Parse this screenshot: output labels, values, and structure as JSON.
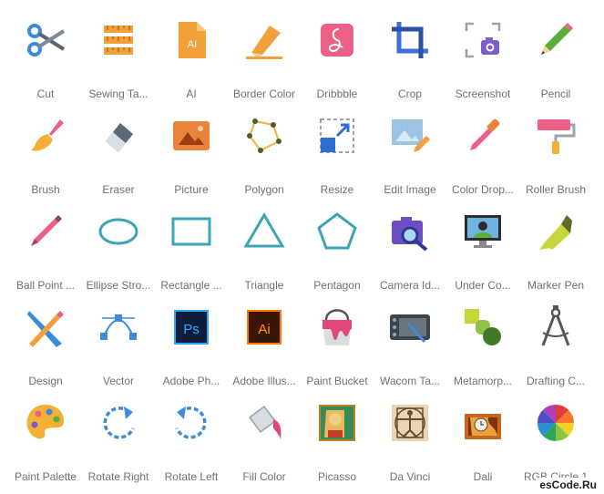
{
  "icons": [
    {
      "label": "Cut",
      "icon": "scissors-icon"
    },
    {
      "label": "Sewing Ta...",
      "icon": "tape-measure-icon"
    },
    {
      "label": "AI",
      "icon": "ai-file-icon"
    },
    {
      "label": "Border Color",
      "icon": "border-color-icon"
    },
    {
      "label": "Dribbble",
      "icon": "dribbble-icon"
    },
    {
      "label": "Crop",
      "icon": "crop-icon"
    },
    {
      "label": "Screenshot",
      "icon": "screenshot-icon"
    },
    {
      "label": "Pencil",
      "icon": "pencil-icon"
    },
    {
      "label": "Brush",
      "icon": "brush-icon"
    },
    {
      "label": "Eraser",
      "icon": "eraser-icon"
    },
    {
      "label": "Picture",
      "icon": "picture-icon"
    },
    {
      "label": "Polygon",
      "icon": "polygon-icon"
    },
    {
      "label": "Resize",
      "icon": "resize-icon"
    },
    {
      "label": "Edit Image",
      "icon": "edit-image-icon"
    },
    {
      "label": "Color Drop...",
      "icon": "color-dropper-icon"
    },
    {
      "label": "Roller Brush",
      "icon": "roller-brush-icon"
    },
    {
      "label": "Ball Point ...",
      "icon": "ball-point-pen-icon"
    },
    {
      "label": "Ellipse Stro...",
      "icon": "ellipse-stroke-icon"
    },
    {
      "label": "Rectangle ...",
      "icon": "rectangle-stroke-icon"
    },
    {
      "label": "Triangle",
      "icon": "triangle-stroke-icon"
    },
    {
      "label": "Pentagon",
      "icon": "pentagon-stroke-icon"
    },
    {
      "label": "Camera Id...",
      "icon": "camera-identification-icon"
    },
    {
      "label": "Under Co...",
      "icon": "under-computer-icon"
    },
    {
      "label": "Marker Pen",
      "icon": "marker-pen-icon"
    },
    {
      "label": "Design",
      "icon": "design-icon"
    },
    {
      "label": "Vector",
      "icon": "vector-icon"
    },
    {
      "label": "Adobe Ph...",
      "icon": "adobe-photoshop-icon"
    },
    {
      "label": "Adobe Illus...",
      "icon": "adobe-illustrator-icon"
    },
    {
      "label": "Paint Bucket",
      "icon": "paint-bucket-icon"
    },
    {
      "label": "Wacom Ta...",
      "icon": "wacom-tablet-icon"
    },
    {
      "label": "Metamorp...",
      "icon": "metamorphose-icon"
    },
    {
      "label": "Drafting C...",
      "icon": "drafting-compass-icon"
    },
    {
      "label": "Paint Palette",
      "icon": "paint-palette-icon"
    },
    {
      "label": "Rotate Right",
      "icon": "rotate-right-icon"
    },
    {
      "label": "Rotate Left",
      "icon": "rotate-left-icon"
    },
    {
      "label": "Fill Color",
      "icon": "fill-color-icon"
    },
    {
      "label": "Picasso",
      "icon": "picasso-icon"
    },
    {
      "label": "Da Vinci",
      "icon": "da-vinci-icon"
    },
    {
      "label": "Dali",
      "icon": "dali-icon"
    },
    {
      "label": "RGB Circle 1",
      "icon": "rgb-circle-icon"
    }
  ],
  "watermark": "esCode.Ru",
  "colors": {
    "label": "#707070",
    "blue": "#3d8bd9",
    "orange": "#f2a13a",
    "teal": "#3ba4b7",
    "pink": "#ec5f87"
  }
}
